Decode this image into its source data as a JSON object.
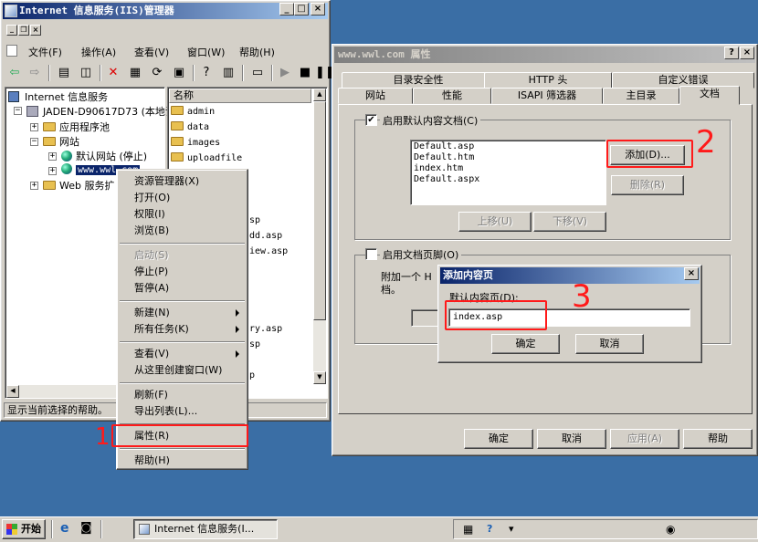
{
  "iis": {
    "title": "Internet 信息服务(IIS)管理器",
    "menu": [
      "文件(F)",
      "操作(A)",
      "查看(V)",
      "窗口(W)",
      "帮助(H)"
    ],
    "tree": {
      "root": "Internet 信息服务",
      "server": "JADEN-D90617D73 (本地计",
      "app_pools": "应用程序池",
      "sites": "网站",
      "default_site": "默认网站 (停止)",
      "selected_site": "www.wwl.com",
      "web_ext": "Web 服务扩"
    },
    "list_header": "名称",
    "list_items": [
      "admin",
      "data",
      "images",
      "uploadfile"
    ],
    "list_partial": [
      "sp",
      "dd.asp",
      "iew.asp",
      "ry.asp",
      "sp",
      "p"
    ],
    "status": "显示当前选择的帮助。"
  },
  "context_menu": {
    "items": [
      {
        "label": "资源管理器(X)",
        "enabled": true
      },
      {
        "label": "打开(O)",
        "enabled": true
      },
      {
        "label": "权限(I)",
        "enabled": true
      },
      {
        "label": "浏览(B)",
        "enabled": true
      },
      {
        "label": "启动(S)",
        "enabled": false
      },
      {
        "label": "停止(P)",
        "enabled": true
      },
      {
        "label": "暂停(A)",
        "enabled": true
      },
      {
        "label": "新建(N)",
        "enabled": true,
        "submenu": true
      },
      {
        "label": "所有任务(K)",
        "enabled": true,
        "submenu": true
      },
      {
        "label": "查看(V)",
        "enabled": true,
        "submenu": true
      },
      {
        "label": "从这里创建窗口(W)",
        "enabled": true
      },
      {
        "label": "刷新(F)",
        "enabled": true
      },
      {
        "label": "导出列表(L)...",
        "enabled": true
      },
      {
        "label": "属性(R)",
        "enabled": true
      },
      {
        "label": "帮助(H)",
        "enabled": true
      }
    ]
  },
  "props": {
    "title": "www.wwl.com 属性",
    "help_btn": "?",
    "tabs_back": [
      "目录安全性",
      "HTTP 头",
      "自定义错误"
    ],
    "tabs_front": [
      "网站",
      "性能",
      "ISAPI 筛选器",
      "主目录",
      "文档"
    ],
    "enable_default_doc": "启用默认内容文档(C)",
    "default_docs": [
      "Default.asp",
      "Default.htm",
      "index.htm",
      "Default.aspx"
    ],
    "add_btn": "添加(D)...",
    "remove_btn": "删除(R)",
    "up_btn": "上移(U)",
    "down_btn": "下移(V)",
    "enable_footer": "启用文档页脚(O)",
    "footer_desc_1": "附加一个 H",
    "footer_desc_2": "档。",
    "ok": "确定",
    "cancel": "取消",
    "apply": "应用(A)",
    "help": "帮助"
  },
  "add_dialog": {
    "title": "添加内容页",
    "label": "默认内容页(D):",
    "value": "index.asp",
    "ok": "确定",
    "cancel": "取消"
  },
  "annotations": [
    "1",
    "2",
    "3"
  ],
  "taskbar": {
    "start": "开始",
    "task": "Internet 信息服务(I..."
  },
  "colors": {
    "desktop": "#3a6ea5",
    "face": "#d4d0c8",
    "title_active": "#0a246a",
    "annotation": "#ff1a1a"
  }
}
